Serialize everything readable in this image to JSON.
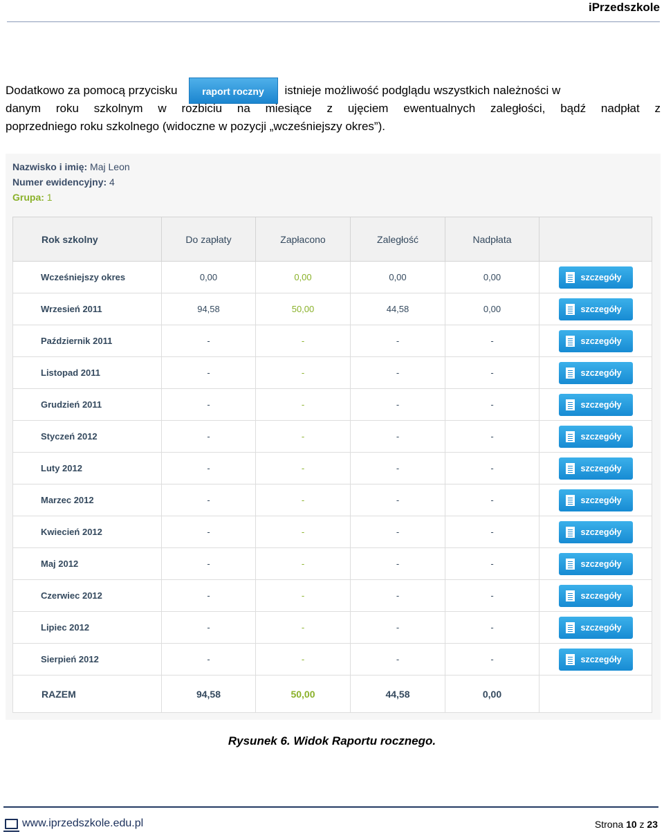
{
  "header": {
    "brand": "iPrzedszkole"
  },
  "intro": {
    "text_before_button": "Dodatkowo za pomocą przycisku",
    "button_label": "raport roczny",
    "text_after_button": "istnieje możliwość podglądu wszystkich należności w",
    "line2": "danym roku szkolnym w rozbiciu na miesiące z ujęciem ewentualnych zaległości, bądź nadpłat z",
    "line3": "poprzedniego roku szkolnego (widoczne w pozycji „wcześniejszy okres”)."
  },
  "student": {
    "name_label": "Nazwisko i imię:",
    "name_value": "Maj Leon",
    "number_label": "Numer ewidencyjny:",
    "number_value": "4",
    "group_label": "Grupa:",
    "group_value": "1"
  },
  "table": {
    "headers": [
      "Rok szkolny",
      "Do zapłaty",
      "Zapłacono",
      "Zaległość",
      "Nadpłata"
    ],
    "details_label": "szczegóły",
    "rows": [
      {
        "month": "Wcześniejszy okres",
        "due": "0,00",
        "paid": "0,00",
        "arrears": "0,00",
        "overpay": "0,00"
      },
      {
        "month": "Wrzesień 2011",
        "due": "94,58",
        "paid": "50,00",
        "arrears": "44,58",
        "overpay": "0,00"
      },
      {
        "month": "Październik 2011",
        "due": "-",
        "paid": "-",
        "arrears": "-",
        "overpay": "-"
      },
      {
        "month": "Listopad 2011",
        "due": "-",
        "paid": "-",
        "arrears": "-",
        "overpay": "-"
      },
      {
        "month": "Grudzień 2011",
        "due": "-",
        "paid": "-",
        "arrears": "-",
        "overpay": "-"
      },
      {
        "month": "Styczeń 2012",
        "due": "-",
        "paid": "-",
        "arrears": "-",
        "overpay": "-"
      },
      {
        "month": "Luty 2012",
        "due": "-",
        "paid": "-",
        "arrears": "-",
        "overpay": "-"
      },
      {
        "month": "Marzec 2012",
        "due": "-",
        "paid": "-",
        "arrears": "-",
        "overpay": "-"
      },
      {
        "month": "Kwiecień 2012",
        "due": "-",
        "paid": "-",
        "arrears": "-",
        "overpay": "-"
      },
      {
        "month": "Maj 2012",
        "due": "-",
        "paid": "-",
        "arrears": "-",
        "overpay": "-"
      },
      {
        "month": "Czerwiec 2012",
        "due": "-",
        "paid": "-",
        "arrears": "-",
        "overpay": "-"
      },
      {
        "month": "Lipiec 2012",
        "due": "-",
        "paid": "-",
        "arrears": "-",
        "overpay": "-"
      },
      {
        "month": "Sierpień 2012",
        "due": "-",
        "paid": "-",
        "arrears": "-",
        "overpay": "-"
      }
    ],
    "total": {
      "label": "RAZEM",
      "due": "94,58",
      "paid": "50,00",
      "arrears": "44,58",
      "overpay": "0,00"
    }
  },
  "caption": "Rysunek 6. Widok Raportu rocznego.",
  "footer": {
    "url": "www.iprzedszkole.edu.pl",
    "page_prefix": "Strona",
    "page_current": "10",
    "page_sep": "z",
    "page_total": "23"
  },
  "colors": {
    "button_blue": "#1b85cf",
    "paid_green": "#8ab12a",
    "footer_navy": "#233a63"
  }
}
